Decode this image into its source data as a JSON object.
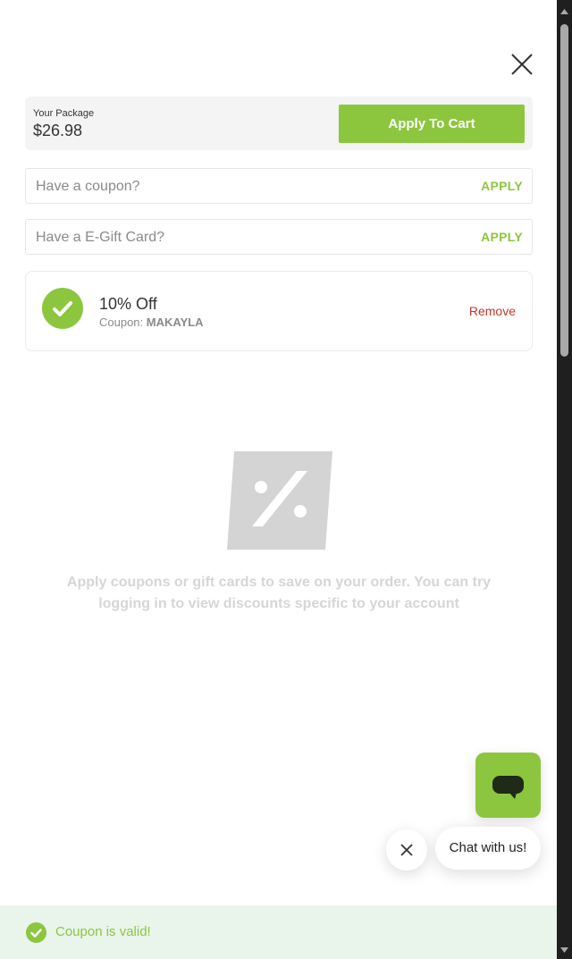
{
  "package": {
    "label": "Your Package",
    "price": "$26.98",
    "apply_to_cart_label": "Apply To Cart"
  },
  "coupon_input": {
    "placeholder": "Have a coupon?",
    "value": "",
    "apply_label": "APPLY"
  },
  "gift_card_input": {
    "placeholder": "Have a E-Gift Card?",
    "value": "",
    "apply_label": "APPLY"
  },
  "applied_coupon": {
    "title": "10% Off",
    "coupon_prefix": "Coupon: ",
    "coupon_code": "MAKAYLA",
    "remove_label": "Remove"
  },
  "empty_state": {
    "icon": "percent-icon",
    "message": "Apply coupons or gift cards to save on your order. You can try logging in to view discounts specific to your account"
  },
  "chat": {
    "bubble_text": "Chat with us!",
    "launcher_icon": "chat-icon",
    "dismiss_icon": "close-icon"
  },
  "toast": {
    "message": "Coupon is valid!",
    "icon": "check-icon"
  },
  "colors": {
    "accent_green": "#8cc63f",
    "remove_red": "#c0392b",
    "toast_bg": "#e9f4ea"
  }
}
